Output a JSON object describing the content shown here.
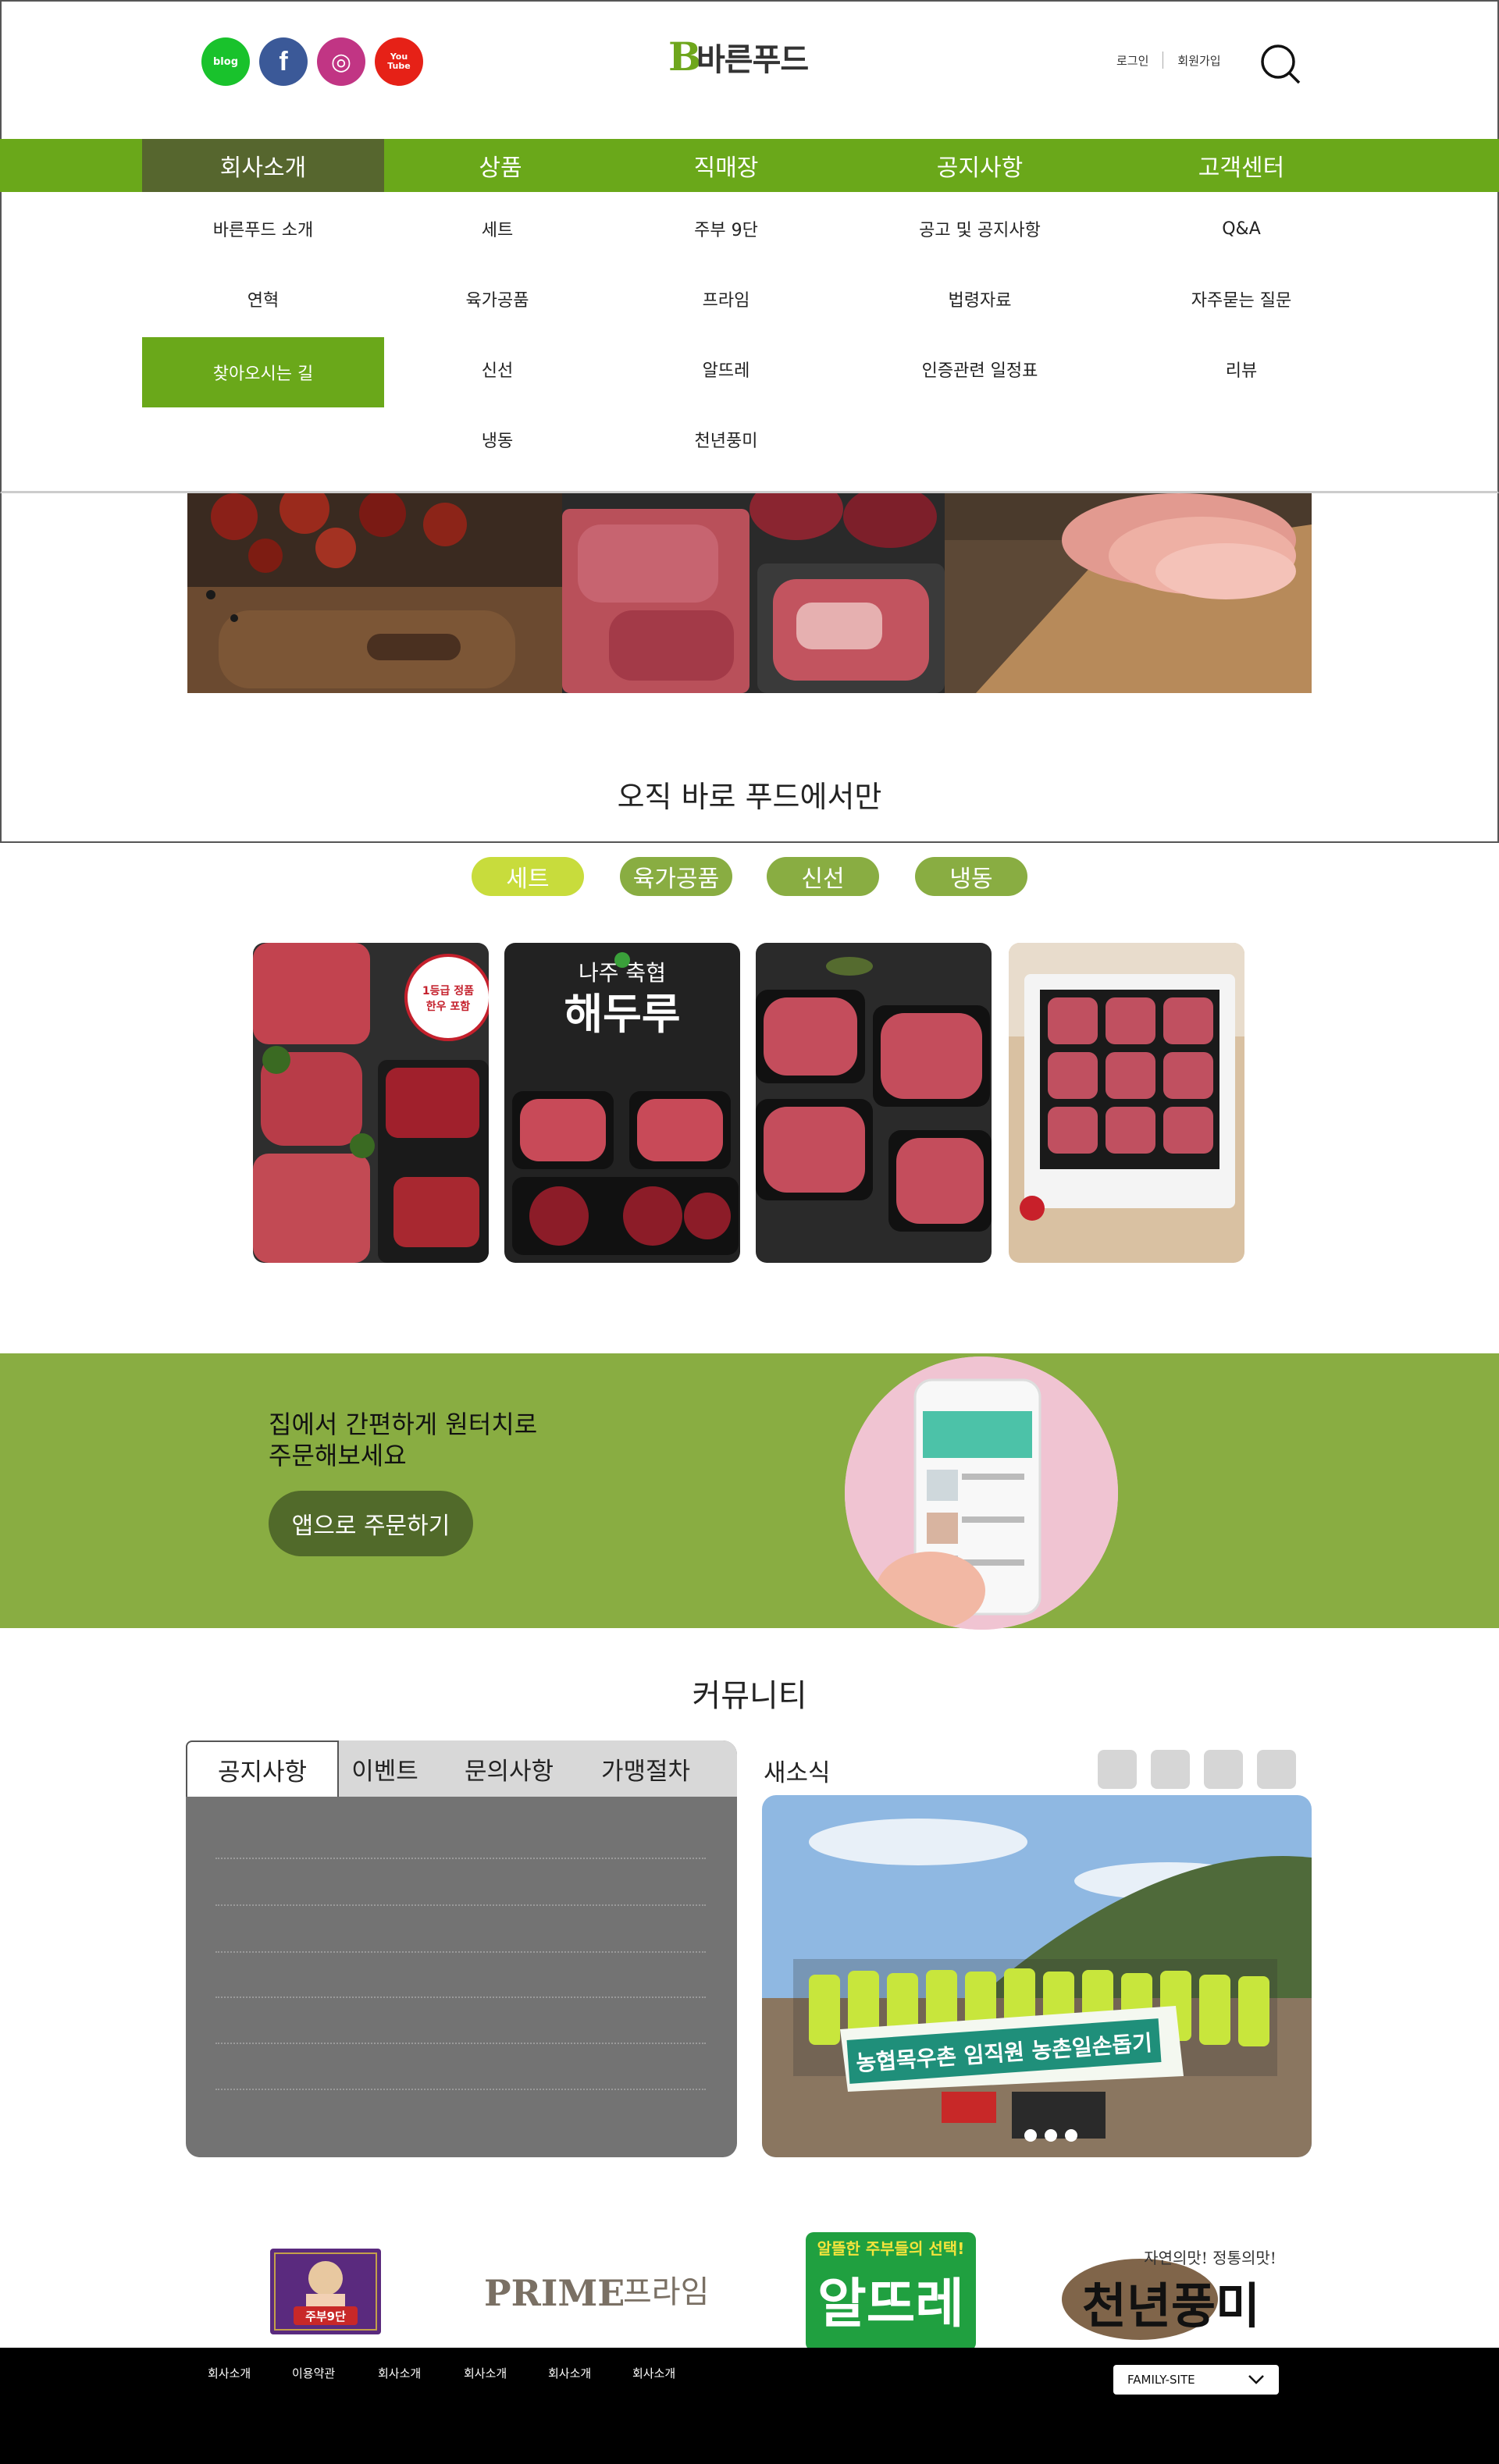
{
  "header": {
    "social": [
      {
        "name": "blog",
        "label": "blog",
        "color": "#19c22c"
      },
      {
        "name": "facebook",
        "label": "f",
        "color": "#3b5998"
      },
      {
        "name": "instagram",
        "label": "◎",
        "color": "#c13584"
      },
      {
        "name": "youtube",
        "label": "You Tube",
        "color": "#e62117"
      }
    ],
    "logo_mark": "B",
    "logo_text": "바른푸드",
    "login": "로그인",
    "signup": "회원가입",
    "search_icon": "search-icon"
  },
  "nav": {
    "items": [
      "회사소개",
      "상품",
      "직매장",
      "공지사항",
      "고객센터"
    ],
    "active_color": "#56662e",
    "bar_color": "#6aa81a"
  },
  "dropdown": {
    "col1": [
      "바른푸드 소개",
      "연혁",
      "찾아오시는 길"
    ],
    "col2": [
      "세트",
      "육가공품",
      "신선",
      "냉동"
    ],
    "col3": [
      "주부 9단",
      "프라임",
      "알뜨레",
      "천년풍미"
    ],
    "col4": [
      "공고 및 공지사항",
      "법령자료",
      "인증관련 일정표"
    ],
    "col5": [
      "Q&A",
      "자주묻는 질문",
      "리뷰"
    ]
  },
  "tagline": "오직 바로 푸드에서만",
  "categories": [
    {
      "label": "세트",
      "color": "#c8dc3c"
    },
    {
      "label": "육가공품",
      "color": "#89ad42"
    },
    {
      "label": "신선",
      "color": "#89ad42"
    },
    {
      "label": "냉동",
      "color": "#89ad42"
    }
  ],
  "product_cards": {
    "card2_line1": "나주",
    "card2_line2": "축협",
    "card2_title": "해두루",
    "card1_badge": "1등급 정품 한우 포함"
  },
  "app_banner": {
    "line1": "집에서 간편하게 원터치로",
    "line2": "주문해보세요",
    "button": "앱으로 주문하기",
    "bg_color": "#89ad42"
  },
  "community": {
    "title": "커뮤니티",
    "tabs": [
      "공지사항",
      "이벤트",
      "문의사항",
      "가맹절차"
    ],
    "news_title": "새소식",
    "banner_text": "농협목우촌 임직원 농촌일손돕기"
  },
  "brands": {
    "jubu": "주부9단",
    "prime_en": "PRIME",
    "prime_ko": "프라임",
    "altre_top": "알뜰한 주부들의 선택!",
    "altre": "알뜨레",
    "cheonnyeon_top": "자연의맛! 정통의맛!",
    "cheonnyeon": "천년풍미"
  },
  "footer": {
    "links": [
      "회사소개",
      "이용약관",
      "회사소개",
      "회사소개",
      "회사소개",
      "회사소개"
    ],
    "family_site": "FAMILY-SITE"
  }
}
